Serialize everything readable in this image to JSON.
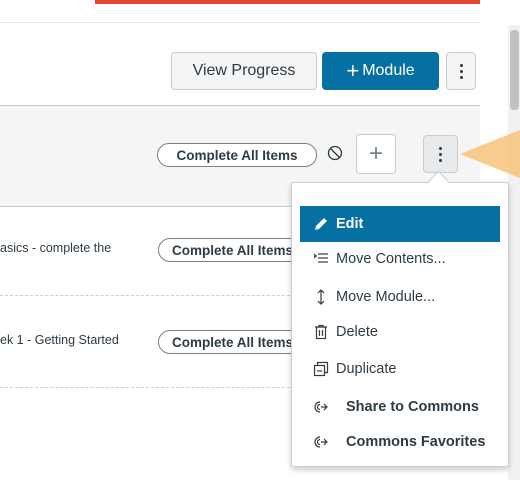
{
  "toolbar": {
    "view_progress_label": "View Progress",
    "module_button_label": "Module",
    "module_button_plus": "+",
    "kebab_icon": "kebab-icon"
  },
  "module": {
    "complete_all_label": "Complete All Items",
    "add_symbol": "+"
  },
  "items": [
    {
      "text": "asics - complete the",
      "complete_all_label": "Complete All Items"
    },
    {
      "text": "ek 1 - Getting Started",
      "complete_all_label": "Complete All Items"
    }
  ],
  "menu": {
    "items": [
      {
        "label": "Edit",
        "icon": "pencil-icon",
        "active": true
      },
      {
        "label": "Move Contents...",
        "icon": "move-contents-icon"
      },
      {
        "label": "Move Module...",
        "icon": "updown-arrow-icon"
      },
      {
        "label": "Delete",
        "icon": "trash-icon"
      },
      {
        "label": "Duplicate",
        "icon": "copy-icon"
      },
      {
        "label": "Share to Commons",
        "icon": "commons-icon"
      },
      {
        "label": "Commons Favorites",
        "icon": "commons-icon"
      }
    ]
  },
  "colors": {
    "accent_blue": "#0770a3",
    "top_accent": "#e0492d",
    "callout": "#f8c37a"
  }
}
